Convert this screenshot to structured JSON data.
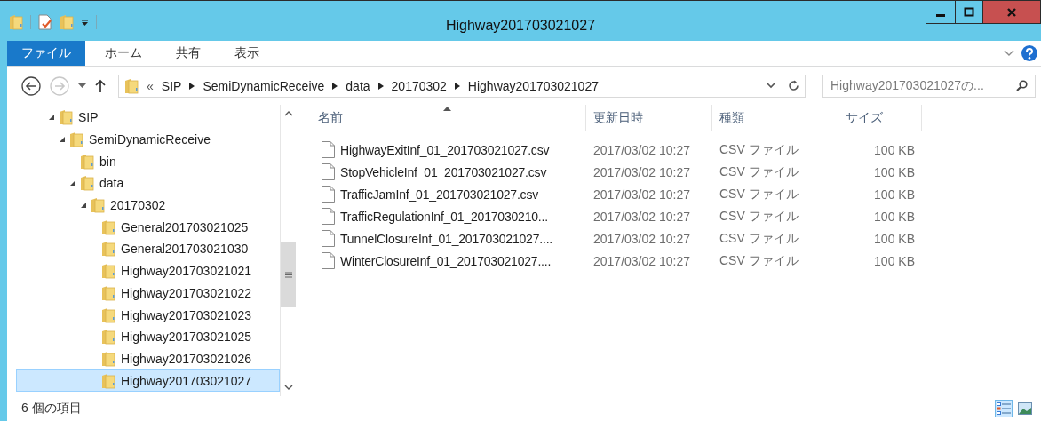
{
  "window": {
    "title": "Highway201703021027"
  },
  "ribbon_tabs": [
    {
      "label": "ファイル",
      "selected": true
    },
    {
      "label": "ホーム",
      "selected": false
    },
    {
      "label": "共有",
      "selected": false
    },
    {
      "label": "表示",
      "selected": false
    }
  ],
  "address": {
    "overflow": "«",
    "segments": [
      "SIP",
      "SemiDynamicReceive",
      "data",
      "20170302",
      "Highway201703021027"
    ]
  },
  "search": {
    "placeholder": "Highway201703021027の..."
  },
  "tree": [
    {
      "label": "SIP",
      "expanded": true,
      "selected": false,
      "children": [
        {
          "label": "SemiDynamicReceive",
          "expanded": true,
          "selected": false,
          "children": [
            {
              "label": "bin",
              "selected": false
            },
            {
              "label": "data",
              "expanded": true,
              "selected": false,
              "children": [
                {
                  "label": "20170302",
                  "expanded": true,
                  "selected": false,
                  "children": [
                    {
                      "label": "General201703021025",
                      "selected": false
                    },
                    {
                      "label": "General201703021030",
                      "selected": false
                    },
                    {
                      "label": "Highway201703021021",
                      "selected": false
                    },
                    {
                      "label": "Highway201703021022",
                      "selected": false
                    },
                    {
                      "label": "Highway201703021023",
                      "selected": false
                    },
                    {
                      "label": "Highway201703021025",
                      "selected": false
                    },
                    {
                      "label": "Highway201703021026",
                      "selected": false
                    },
                    {
                      "label": "Highway201703021027",
                      "selected": true
                    }
                  ]
                }
              ]
            }
          ]
        }
      ]
    }
  ],
  "columns": [
    {
      "label": "名前",
      "sorted": true
    },
    {
      "label": "更新日時",
      "sorted": false
    },
    {
      "label": "種類",
      "sorted": false
    },
    {
      "label": "サイズ",
      "sorted": false
    }
  ],
  "files": [
    {
      "name": "HighwayExitInf_01_201703021027.csv",
      "modified": "2017/03/02 10:27",
      "type": "CSV ファイル",
      "size": "100 KB"
    },
    {
      "name": "StopVehicleInf_01_201703021027.csv",
      "modified": "2017/03/02 10:27",
      "type": "CSV ファイル",
      "size": "100 KB"
    },
    {
      "name": "TrafficJamInf_01_201703021027.csv",
      "modified": "2017/03/02 10:27",
      "type": "CSV ファイル",
      "size": "100 KB"
    },
    {
      "name": "TrafficRegulationInf_01_2017030210...",
      "modified": "2017/03/02 10:27",
      "type": "CSV ファイル",
      "size": "100 KB"
    },
    {
      "name": "TunnelClosureInf_01_201703021027....",
      "modified": "2017/03/02 10:27",
      "type": "CSV ファイル",
      "size": "100 KB"
    },
    {
      "name": "WinterClosureInf_01_201703021027....",
      "modified": "2017/03/02 10:27",
      "type": "CSV ファイル",
      "size": "100 KB"
    }
  ],
  "status_bar": {
    "count": "6 個の項目"
  },
  "views": [
    {
      "kind": "details",
      "selected": true
    },
    {
      "kind": "large-icons",
      "selected": false
    }
  ]
}
